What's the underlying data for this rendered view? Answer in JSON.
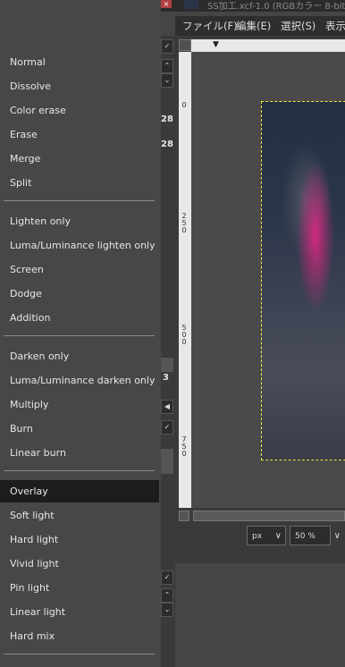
{
  "window": {
    "title": "SS加工.xcf-1.0 (RGBカラー 8-bit",
    "close_glyph": "×"
  },
  "menubar": [
    "ファイル(F)",
    "編集(E)",
    "選択(S)",
    "表示"
  ],
  "left_strip": {
    "numbers": [
      "28",
      "28"
    ],
    "digit": "3"
  },
  "rulers": {
    "vertical_labels": [
      "0",
      "250",
      "500",
      "750"
    ],
    "arrow": "▼"
  },
  "statusbar": {
    "unit": "px",
    "zoom": "50 %",
    "cut_text": "p"
  },
  "blend_menu": {
    "groups": [
      [
        "Normal",
        "Dissolve",
        "Color erase",
        "Erase",
        "Merge",
        "Split"
      ],
      [
        "Lighten only",
        "Luma/Luminance lighten only",
        "Screen",
        "Dodge",
        "Addition"
      ],
      [
        "Darken only",
        "Luma/Luminance darken only",
        "Multiply",
        "Burn",
        "Linear burn"
      ],
      [
        "Overlay",
        "Soft light",
        "Hard light",
        "Vivid light",
        "Pin light",
        "Linear light",
        "Hard mix"
      ]
    ],
    "selected": "Overlay"
  }
}
